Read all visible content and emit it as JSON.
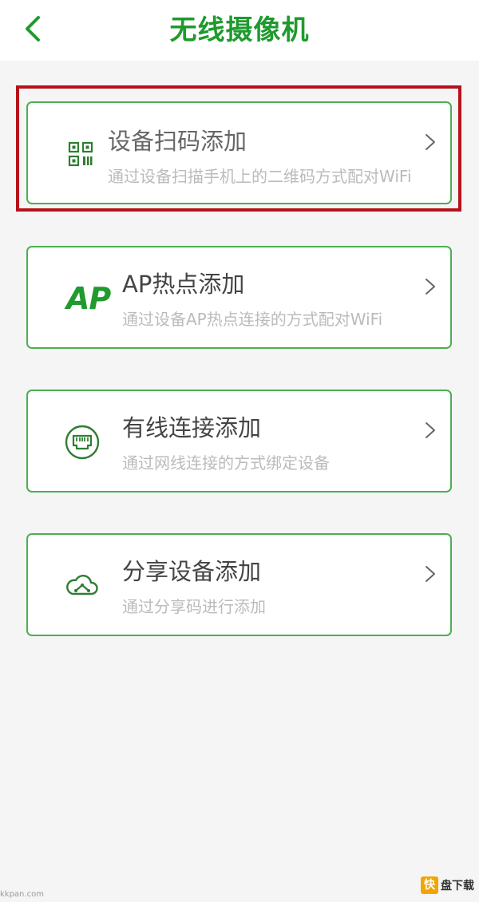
{
  "header": {
    "title": "无线摄像机",
    "back_icon": "chevron-left-icon"
  },
  "options": [
    {
      "icon": "qr-code-icon",
      "title": "设备扫码添加",
      "description": "通过设备扫描手机上的二维码方式配对WiFi"
    },
    {
      "icon": "ap-text-icon",
      "icon_text": "AP",
      "title": "AP热点添加",
      "description": "通过设备AP热点连接的方式配对WiFi"
    },
    {
      "icon": "ethernet-port-icon",
      "title": "有线连接添加",
      "description": "通过网线连接的方式绑定设备"
    },
    {
      "icon": "cloud-share-icon",
      "title": "分享设备添加",
      "description": "通过分享码进行添加"
    }
  ],
  "watermark": {
    "left": "kkpan.com",
    "right_logo": "快",
    "right_text": "盘下载"
  },
  "colors": {
    "accent": "#1f9a2e",
    "card_border": "#4caf50",
    "highlight": "#b5121b",
    "background": "#f5f5f5"
  }
}
